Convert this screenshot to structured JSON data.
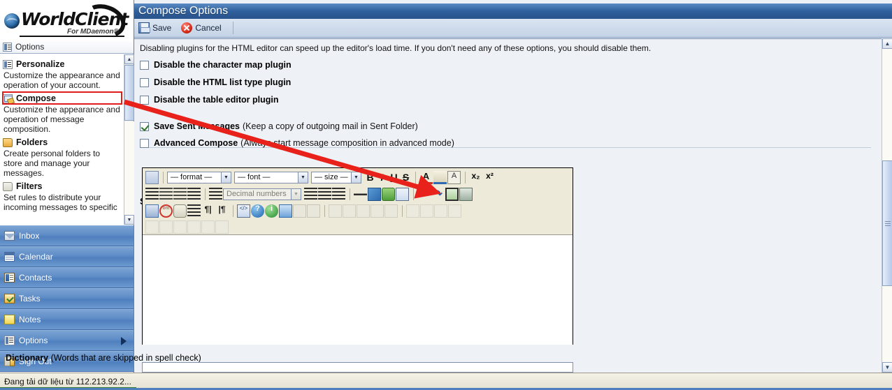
{
  "brand": {
    "name": "WorldClient",
    "subtitle": "For MDaemon®",
    "logo_icon": "globe-icon"
  },
  "sidebar": {
    "header": {
      "label": "Options",
      "icon": "options-icon"
    },
    "options": [
      {
        "title": "Personalize",
        "icon": "personalize-icon",
        "desc": "Customize the appearance and operation of your account."
      },
      {
        "title": "Compose",
        "icon": "compose-icon",
        "desc": "Customize the appearance and operation of message composition."
      },
      {
        "title": "Folders",
        "icon": "folders-icon",
        "desc": "Create personal folders to store and manage your messages."
      },
      {
        "title": "Filters",
        "icon": "filters-icon",
        "desc": "Set rules to distribute your incoming messages to specific"
      }
    ],
    "scroll": {
      "up": "▲",
      "down": "▼"
    },
    "nav": [
      {
        "label": "Inbox",
        "icon": "inbox-icon"
      },
      {
        "label": "Calendar",
        "icon": "calendar-icon"
      },
      {
        "label": "Contacts",
        "icon": "contacts-icon"
      },
      {
        "label": "Tasks",
        "icon": "tasks-icon"
      },
      {
        "label": "Notes",
        "icon": "notes-icon"
      },
      {
        "label": "Options",
        "icon": "options-icon"
      },
      {
        "label": "Sign Out",
        "icon": "signout-icon"
      }
    ]
  },
  "header": {
    "title": "Compose Options"
  },
  "toolbar": {
    "save_label": "Save",
    "cancel_label": "Cancel",
    "save_icon": "floppy-disk-icon",
    "cancel_icon": "cancel-circle-icon"
  },
  "main": {
    "intro": "Disabling plugins for the HTML editor can speed up the editor's load time. If you don't need any of these options, you should disable them.",
    "plugin_options": [
      {
        "label": "Disable the character map plugin",
        "checked": false
      },
      {
        "label": "Disable the HTML list type plugin",
        "checked": false
      },
      {
        "label": "Disable the table editor plugin",
        "checked": false
      }
    ],
    "compose_options": [
      {
        "label": "Save Sent Messages",
        "note": "(Keep a copy of outgoing mail in Sent Folder)",
        "checked": true
      },
      {
        "label": "Advanced Compose",
        "note": "(Always start message composition in advanced mode)",
        "checked": false
      }
    ],
    "signature": {
      "label": "Signature",
      "content": "",
      "editor": {
        "format_select": "— format —",
        "font_select": "— font —",
        "size_select": "— size —",
        "list_select": "Decimal numbers",
        "bold": "B",
        "italic": "I",
        "underline": "U",
        "strike": "S",
        "font_color": "A",
        "bg_color": "A",
        "remove_format": "A",
        "subscript": "x₂",
        "superscript": "x²"
      }
    },
    "dictionary": {
      "label": "Dictionary",
      "note": "(Words that are skipped in spell check)",
      "value": "",
      "placeholder": ""
    }
  },
  "annotation": {
    "color": "#e8211a",
    "highlight_target": "Compose",
    "arrow_target": "insert-image-button"
  },
  "statusbar": {
    "text": "Đang tải dữ liệu từ 112.213.92.2..."
  }
}
